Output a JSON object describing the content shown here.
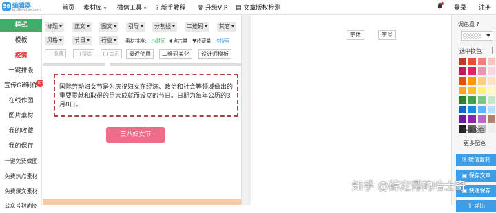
{
  "logo": {
    "mark": "96",
    "name": "编辑器",
    "sub": "bj.96weixin.com"
  },
  "nav": {
    "items": [
      "首页",
      "素材库",
      "微信工具",
      "新手教程",
      "升级VIP",
      "文章版权检测"
    ],
    "login": "登录",
    "register": "注册"
  },
  "sidebar": {
    "items": [
      "样式",
      "模板",
      "疫情",
      "一键排版",
      "宣传Gif制作",
      "在线作图",
      "图片素材",
      "我的收藏",
      "我的保存",
      "一键免费做图",
      "免费热点素材",
      "免费爆文素材",
      "公众号封面图"
    ],
    "hot": "HOT"
  },
  "toolbar": {
    "row1": [
      "标题",
      "正文",
      "图文",
      "引导",
      "分割线",
      "二维码",
      "其它"
    ],
    "row2": [
      "风格",
      "节日",
      "行业"
    ],
    "sort_label": "素材排序:",
    "sort_time": "时间",
    "sort_likes": "点击量",
    "sort_fav": "收藏量",
    "search": "搜索",
    "row3_checks": [
      "收藏",
      "精选",
      "会员"
    ],
    "row3_buttons": [
      "最近使用",
      "二维码美化",
      "设计师模板"
    ]
  },
  "content": {
    "card_text": "国际劳动妇女节是为庆祝妇女在经济、政治和社会等领域做出的重要贡献和取得的巨大成就而设立的节日。日期为每年公历的3月8日。",
    "button_text": "三八妇女节"
  },
  "editor": {
    "font_label": "字体",
    "size_label": "字号"
  },
  "palette": {
    "title": "调色盘",
    "select_label": "选中换色",
    "gradient": "渐变色",
    "more": "更多配色",
    "colors": [
      [
        "#c0392b",
        "#e74c3c",
        "#f08080",
        "#f7c6c0"
      ],
      [
        "#c2185b",
        "#e91e63",
        "#f48fb1",
        "#f8d7e3"
      ],
      [
        "#e65100",
        "#ff9800",
        "#ffcc80",
        "#fde4c3"
      ],
      [
        "#f9a825",
        "#fbc02d",
        "#fff176",
        "#fff9c4"
      ],
      [
        "#2e7d32",
        "#43a047",
        "#81c784",
        "#c8e6c9"
      ],
      [
        "#1565c0",
        "#1e88e5",
        "#64b5f6",
        "#bbdefb"
      ],
      [
        "#6a1b9a",
        "#8e24aa",
        "#ba68c8",
        "#b57f6e"
      ],
      [
        "#212121",
        "#616161",
        "#bdbdbd",
        "#eeeeee"
      ]
    ],
    "buttons": [
      "微信复制",
      "保存文章",
      "快速保存",
      "导出"
    ]
  },
  "watermark": "知乎 @薛定谔的哈士奇"
}
